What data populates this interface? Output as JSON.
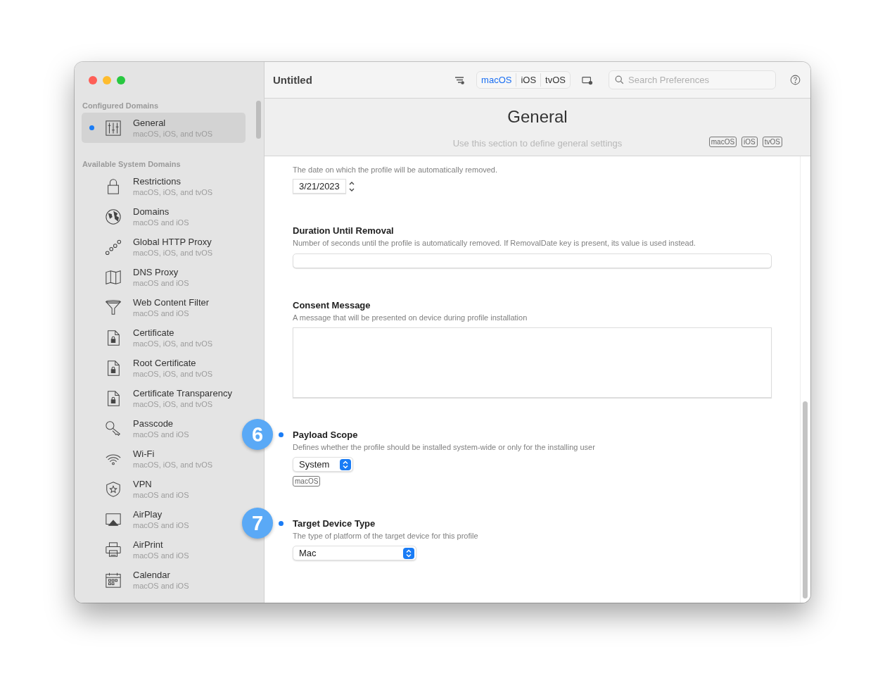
{
  "window": {
    "title": "Untitled"
  },
  "toolbar": {
    "platforms": [
      {
        "label": "macOS",
        "selected": true
      },
      {
        "label": "iOS",
        "selected": false
      },
      {
        "label": "tvOS",
        "selected": false
      }
    ],
    "search": {
      "placeholder": "Search Preferences"
    }
  },
  "sidebar": {
    "sections": [
      {
        "title": "Configured Domains",
        "items": [
          {
            "name": "General",
            "platforms": "macOS, iOS, and tvOS",
            "selected": true,
            "configured": true
          }
        ]
      },
      {
        "title": "Available System Domains",
        "items": [
          {
            "name": "Restrictions",
            "platforms": "macOS, iOS, and tvOS",
            "selected": false,
            "configured": false
          },
          {
            "name": "Domains",
            "platforms": "macOS and iOS",
            "selected": false,
            "configured": false
          },
          {
            "name": "Global HTTP Proxy",
            "platforms": "macOS, iOS, and tvOS",
            "selected": false,
            "configured": false
          },
          {
            "name": "DNS Proxy",
            "platforms": "macOS and iOS",
            "selected": false,
            "configured": false
          },
          {
            "name": "Web Content Filter",
            "platforms": "macOS and iOS",
            "selected": false,
            "configured": false
          },
          {
            "name": "Certificate",
            "platforms": "macOS, iOS, and tvOS",
            "selected": false,
            "configured": false
          },
          {
            "name": "Root Certificate",
            "platforms": "macOS, iOS, and tvOS",
            "selected": false,
            "configured": false
          },
          {
            "name": "Certificate Transparency",
            "platforms": "macOS, iOS, and tvOS",
            "selected": false,
            "configured": false
          },
          {
            "name": "Passcode",
            "platforms": "macOS and iOS",
            "selected": false,
            "configured": false
          },
          {
            "name": "Wi-Fi",
            "platforms": "macOS, iOS, and tvOS",
            "selected": false,
            "configured": false
          },
          {
            "name": "VPN",
            "platforms": "macOS and iOS",
            "selected": false,
            "configured": false
          },
          {
            "name": "AirPlay",
            "platforms": "macOS and iOS",
            "selected": false,
            "configured": false
          },
          {
            "name": "AirPrint",
            "platforms": "macOS and iOS",
            "selected": false,
            "configured": false
          },
          {
            "name": "Calendar",
            "platforms": "macOS and iOS",
            "selected": false,
            "configured": false
          }
        ]
      }
    ]
  },
  "section": {
    "title": "General",
    "description": "Use this section to define general settings",
    "platforms": [
      "macOS",
      "iOS",
      "tvOS"
    ]
  },
  "fields": [
    {
      "kind": "date",
      "description": "The date on which the profile will be automatically removed.",
      "value": "3/21/2023",
      "modified": false
    },
    {
      "kind": "text",
      "title": "Duration Until Removal",
      "description": "Number of seconds until the profile is automatically removed. If RemovalDate key is present, its value is used instead.",
      "modified": false
    },
    {
      "kind": "textarea",
      "title": "Consent Message",
      "description": "A message that will be presented on device during profile installation",
      "modified": false
    },
    {
      "kind": "popup",
      "title": "Payload Scope",
      "description": "Defines whether the profile should be installed system-wide or only for the installing user",
      "value": "System",
      "modified": true,
      "callout": "6",
      "platforms": [
        "macOS"
      ],
      "wide": false
    },
    {
      "kind": "popup",
      "title": "Target Device Type",
      "description": "The type of platform of the target device for this profile",
      "value": "Mac",
      "modified": true,
      "callout": "7",
      "wide": true
    }
  ]
}
